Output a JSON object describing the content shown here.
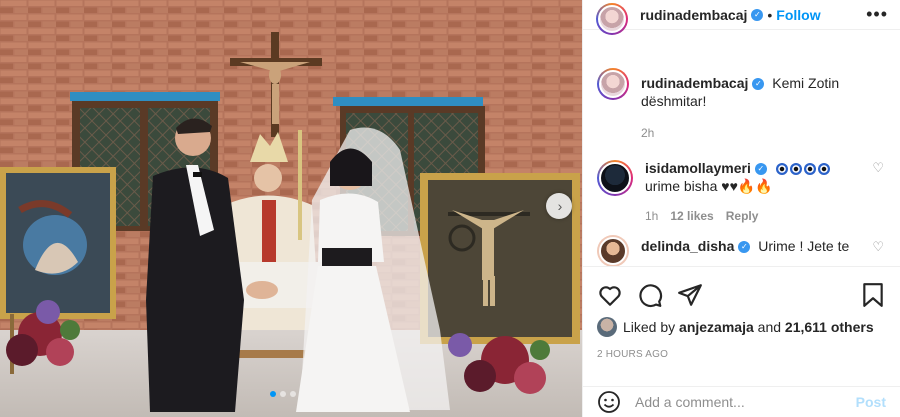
{
  "post": {
    "username": "rudinadembacaj",
    "follow_label": "Follow",
    "more_label": "•••",
    "carousel": {
      "next_icon": "chevron-right-icon",
      "slides": 3,
      "active_slide": 1
    }
  },
  "caption": {
    "username": "rudinadembacaj",
    "text_line1": "Kemi Zotin",
    "text_line2": "dëshmitar!",
    "time": "2h"
  },
  "comments": [
    {
      "username": "isidamollaymeri",
      "text_line2": "urime bisha ♥♥🔥🔥",
      "time": "1h",
      "likes": "12 likes",
      "reply_label": "Reply"
    },
    {
      "username": "delinda_disha",
      "text": "Urime ! Jete te"
    }
  ],
  "likes": {
    "prefix": "Liked by",
    "user": "anjezamaja",
    "mid": "and",
    "count": "21,611 others"
  },
  "time_ago": "2 HOURS AGO",
  "add_comment": {
    "placeholder": "Add a comment...",
    "post_label": "Post"
  },
  "colors": {
    "accent": "#0095f6",
    "verified": "#3897f0",
    "muted": "#8e8e8e"
  },
  "icons": [
    "verified-icon",
    "heart-icon",
    "comment-icon",
    "share-icon",
    "bookmark-icon",
    "emoji-icon",
    "chevron-right-icon"
  ]
}
